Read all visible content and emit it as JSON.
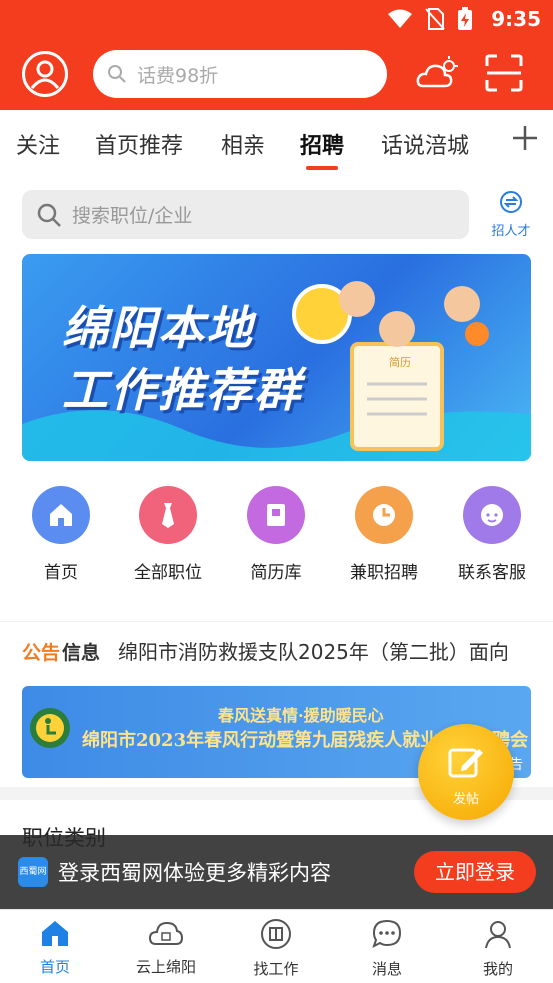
{
  "status": {
    "time": "9:35"
  },
  "header": {
    "search_placeholder": "话费98折"
  },
  "tabs": [
    {
      "label": "关注",
      "active": false
    },
    {
      "label": "首页推荐",
      "active": false
    },
    {
      "label": "相亲",
      "active": false
    },
    {
      "label": "招聘",
      "active": true
    },
    {
      "label": "话说涪城",
      "active": false
    }
  ],
  "jobsearch": {
    "placeholder": "搜索职位/企业",
    "recruit_label": "招人才"
  },
  "banner": {
    "line1": "绵阳本地",
    "line2": "工作推荐群",
    "resume_tag": "简历"
  },
  "quick_actions": [
    {
      "label": "首页",
      "icon": "home-icon",
      "color": "#5b8df0"
    },
    {
      "label": "全部职位",
      "icon": "tie-icon",
      "color": "#f0637a"
    },
    {
      "label": "简历库",
      "icon": "resume-book-icon",
      "color": "#c46ae0"
    },
    {
      "label": "兼职招聘",
      "icon": "clock-icon",
      "color": "#f5a04a"
    },
    {
      "label": "联系客服",
      "icon": "service-agent-icon",
      "color": "#a07ae8"
    }
  ],
  "notice": {
    "tag_a": "公告",
    "tag_b": "信息",
    "text": "绵阳市消防救援支队2025年（第二批）面向"
  },
  "adbanner": {
    "line1": "春风送真情·援助暖民心",
    "line2": "绵阳市2023年春风行动暨第九届残疾人就业专场招聘会",
    "tag": "告"
  },
  "section": {
    "title": "职位类别"
  },
  "login": {
    "logo_text": "西蜀网",
    "message": "登录西蜀网体验更多精彩内容",
    "button": "立即登录"
  },
  "fab": {
    "label": "发帖"
  },
  "bottom_nav": [
    {
      "label": "首页",
      "icon": "home-icon",
      "active": true
    },
    {
      "label": "云上绵阳",
      "icon": "cloud-icon",
      "active": false
    },
    {
      "label": "找工作",
      "icon": "job-icon",
      "active": false
    },
    {
      "label": "消息",
      "icon": "message-icon",
      "active": false
    },
    {
      "label": "我的",
      "icon": "user-icon",
      "active": false
    }
  ],
  "colors": {
    "brand": "#f43c1f",
    "accent_blue": "#1f80e6",
    "fab": "#f6a800"
  }
}
